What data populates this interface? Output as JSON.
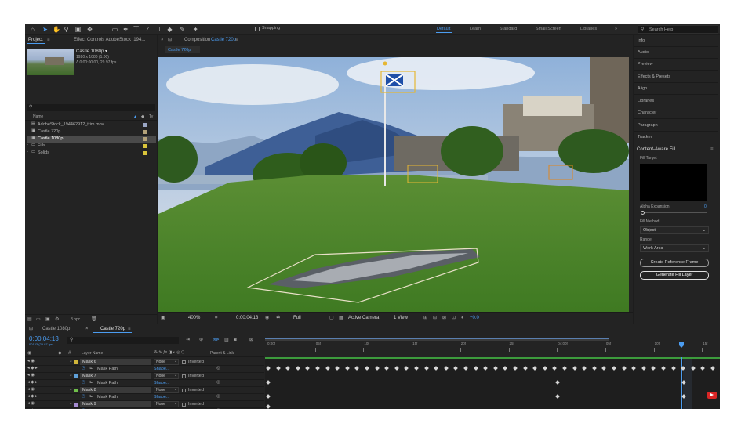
{
  "toolbar": {
    "snapping": "Snapping",
    "workspaces": [
      "Default",
      "Learn",
      "Standard",
      "Small Screen",
      "Libraries"
    ],
    "active_workspace": "Default",
    "search_placeholder": "Search Help"
  },
  "project": {
    "tab": "Project",
    "effect_tab": "Effect Controls AdobeStock_194...",
    "preview": {
      "name": "Castle 1080p ▾",
      "dims": "1920 x 1080 (1.00)",
      "duration": "Δ 0:00:00:00, 29.97 fps"
    },
    "col_name": "Name",
    "col_type": "Ty",
    "items": [
      {
        "name": "AdobeStock_194462912_trim.mov",
        "color": "#9aa6c4"
      },
      {
        "name": "Castle 720p",
        "color": "#b3a27a"
      },
      {
        "name": "Castle 1080p",
        "color": "#b3a27a"
      },
      {
        "name": "Fills",
        "color": "#d9c43a"
      },
      {
        "name": "Solids",
        "color": "#d9c43a"
      }
    ],
    "bpc": "8 bpc"
  },
  "composition": {
    "tab_label": "Composition",
    "tab_name": "Castle 720p",
    "subtab": "Castle 720p",
    "zoom": "400%",
    "timecode": "0:00:04:13",
    "resolution": "Full",
    "camera": "Active Camera",
    "view": "1 View",
    "exposure": "+0.0"
  },
  "right_panel": {
    "items": [
      "Info",
      "Audio",
      "Preview",
      "Effects & Presets",
      "Align",
      "Libraries",
      "Character",
      "Paragraph",
      "Tracker"
    ],
    "caf": {
      "title": "Content-Aware Fill",
      "fill_target": "Fill Target",
      "alpha_label": "Alpha Expansion",
      "alpha_value": "0",
      "method_label": "Fill Method",
      "method_value": "Object",
      "range_label": "Range",
      "range_value": "Work Area",
      "create_btn": "Create Reference Frame",
      "generate_btn": "Generate Fill Layer"
    }
  },
  "timeline": {
    "tabs": [
      "Castle 1080p",
      "Castle 720p"
    ],
    "timecode": "0:00:04:13",
    "subtime": "00133 (29.97 fps)",
    "col_layer": "Layer Name",
    "col_parent": "Parent & Link",
    "ruler": [
      "0:00f",
      "05f",
      "10f",
      "15f",
      "20f",
      "25f",
      "04:00f",
      "05f",
      "10f",
      "15f"
    ],
    "rows": [
      {
        "type": "mask",
        "name": "Mask 6",
        "mode": "None",
        "inverted": "Inverted",
        "color": "#d0b53a"
      },
      {
        "type": "path",
        "name": "Mask Path",
        "value": "Shape..."
      },
      {
        "type": "mask",
        "name": "Mask 7",
        "mode": "None",
        "inverted": "Inverted",
        "color": "#5fa0d8"
      },
      {
        "type": "path",
        "name": "Mask Path",
        "value": "Shape..."
      },
      {
        "type": "mask",
        "name": "Mask 8",
        "mode": "None",
        "inverted": "Inverted",
        "color": "#6fbf4a"
      },
      {
        "type": "path",
        "name": "Mask Path",
        "value": "Shape..."
      },
      {
        "type": "mask",
        "name": "Mask 9",
        "mode": "None",
        "inverted": "Inverted",
        "color": "#a48ad0"
      },
      {
        "type": "path",
        "name": "Mask Path",
        "value": "Shape..."
      }
    ]
  }
}
